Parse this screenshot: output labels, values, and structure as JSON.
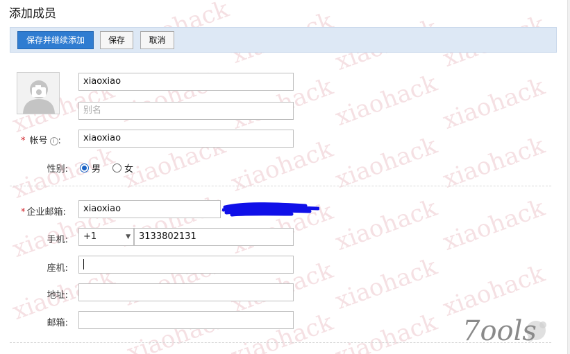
{
  "page_title": "添加成员",
  "toolbar": {
    "save_and_continue_label": "保存并继续添加",
    "save_label": "保存",
    "cancel_label": "取消"
  },
  "form": {
    "name_value": "xiaoxiao",
    "alias_placeholder": "别名",
    "account_label": "帐号",
    "account_value": "xiaoxiao",
    "gender_label": "性别:",
    "gender_options": [
      "男",
      "女"
    ],
    "gender_selected": "男",
    "email_label": "企业邮箱:",
    "email_value": "xiaoxiao",
    "phone_label": "手机:",
    "phone_country_code": "+1",
    "phone_value": "3133802131",
    "landline_label": "座机:",
    "landline_value": "",
    "address_label": "地址:",
    "address_value": "",
    "mailbox_label": "邮箱:",
    "mailbox_value": "",
    "required_mark": "*",
    "info_icon_glyph": "i",
    "colon": ":"
  },
  "watermark_text": "xiaohack",
  "logo_text": "7ools",
  "colors": {
    "primary_button": "#2f7cd1",
    "toolbar_bg": "#dde8f5",
    "required": "#d0232a",
    "radio_checked": "#1a62c4",
    "redaction": "#1010e8"
  }
}
